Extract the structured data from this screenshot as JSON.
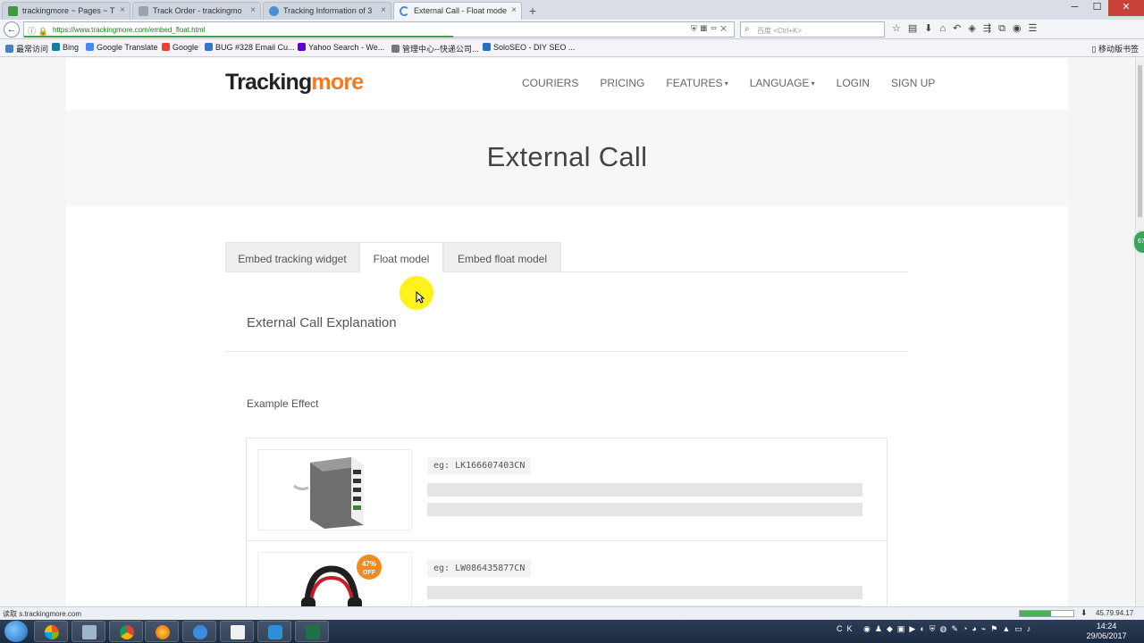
{
  "browser": {
    "tabs": [
      {
        "title": "trackingmore ~ Pages ~ T",
        "active": false,
        "color": "#3b9c3b"
      },
      {
        "title": "Track Order - trackingmo",
        "active": false,
        "color": "#9aa4ae"
      },
      {
        "title": "Tracking Information of 3",
        "active": false,
        "color": "#4c8ed4"
      },
      {
        "title": "External Call - Float mode",
        "active": true,
        "color": "#4c8ed4"
      }
    ],
    "new_tab": "+",
    "url": "https://www.trackingmore.com/embed_float.html",
    "search_placeholder": "百度 <Ctrl+K>",
    "bookmarks": [
      {
        "label": "最常访问",
        "color": "#4a7fbf"
      },
      {
        "label": "Bing",
        "color": "#137ca0"
      },
      {
        "label": "Google Translate",
        "color": "#4a85f0"
      },
      {
        "label": "Google",
        "color": "#ea4335"
      },
      {
        "label": "BUG #328 Email Cu...",
        "color": "#3377cc"
      },
      {
        "label": "Yahoo Search - We...",
        "color": "#5f01d1"
      },
      {
        "label": "管理中心--快递公司...",
        "color": "#777777"
      },
      {
        "label": "SoloSEO - DIY SEO ...",
        "color": "#2a6ebf"
      }
    ],
    "mobile_bookmarks": "移动版书签",
    "status_text": "s.trackingmore.com",
    "ip": "45.79.94.17"
  },
  "site": {
    "logo_main": "Tracking",
    "logo_accent": "more",
    "nav": [
      {
        "label": "COURIERS",
        "dropdown": false
      },
      {
        "label": "PRICING",
        "dropdown": false
      },
      {
        "label": "FEATURES",
        "dropdown": true
      },
      {
        "label": "LANGUAGE",
        "dropdown": true
      },
      {
        "label": "LOGIN",
        "dropdown": false
      },
      {
        "label": "SIGN UP",
        "dropdown": false
      }
    ],
    "page_title": "External Call",
    "tabs": [
      {
        "label": "Embed tracking widget",
        "active": false
      },
      {
        "label": "Float model",
        "active": true
      },
      {
        "label": "Embed float model",
        "active": false
      }
    ],
    "section_title": "External Call Explanation",
    "example_label": "Example Effect",
    "examples": [
      {
        "code": "eg: LK166607403CN",
        "product": "usb-charger"
      },
      {
        "code": "eg: LW086435877CN",
        "product": "headphones",
        "badge_pct": "47%",
        "badge_off": "OFF"
      }
    ],
    "side_badge": "67"
  },
  "taskbar": {
    "tray_lang": "CK",
    "time": "14:24",
    "date": "29/06/2017"
  }
}
